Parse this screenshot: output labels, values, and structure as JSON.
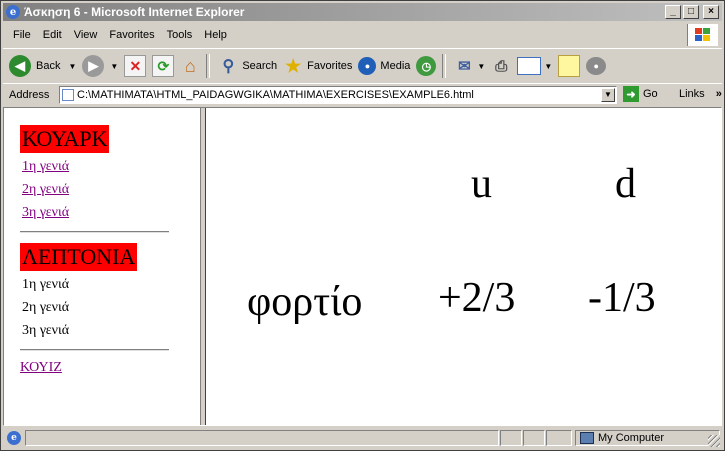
{
  "window": {
    "title": "Άσκηση 6 - Microsoft Internet Explorer"
  },
  "menu": [
    "File",
    "Edit",
    "View",
    "Favorites",
    "Tools",
    "Help"
  ],
  "toolbar": {
    "back_label": "Back",
    "search_label": "Search",
    "favorites_label": "Favorites",
    "media_label": "Media"
  },
  "address": {
    "label": "Address",
    "value": "C:\\MATHIMATA\\HTML_PAIDAGWGIKA\\MATHIMA\\EXERCISES\\EXAMPLE6.html",
    "go_label": "Go",
    "links_label": "Links"
  },
  "left_frame": {
    "section1_title": "ΚΟΥΑΡΚ",
    "section1_links": [
      "1η γενιά",
      "2η γενιά",
      "3η γενιά"
    ],
    "section2_title": "ΛΕΠΤΟΝΙΑ",
    "section2_items": [
      "1η γενιά",
      "2η γενιά",
      "3η γενιά"
    ],
    "quiz_link": "ΚΟΥΙΖ"
  },
  "main_table": {
    "header_u": "u",
    "header_d": "d",
    "row_label": "φορτίο",
    "value_u": "+2/3",
    "value_d": "-1/3"
  },
  "status": {
    "zone": "My Computer"
  },
  "colors": {
    "heading_bg": "#ff0000",
    "visited_link": "#800080"
  }
}
